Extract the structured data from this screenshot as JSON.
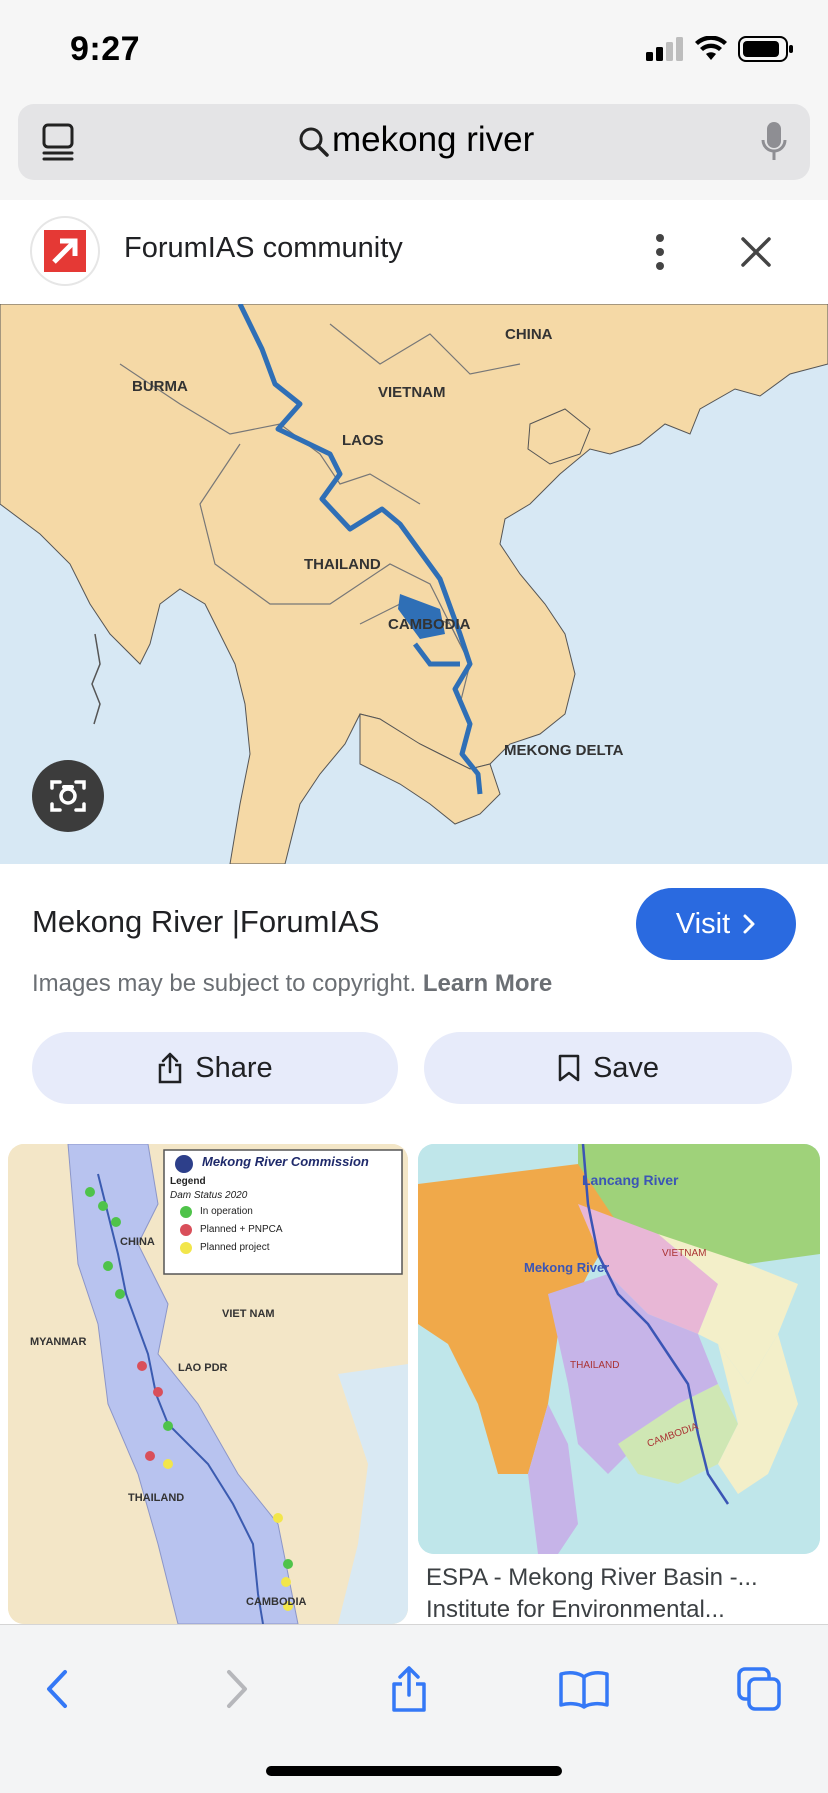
{
  "status_bar": {
    "time": "9:27"
  },
  "search": {
    "query": "mekong river"
  },
  "source": {
    "name": "ForumIAS community"
  },
  "map_labels": {
    "china": "CHINA",
    "burma": "BURMA",
    "vietnam": "VIETNAM",
    "laos": "LAOS",
    "thailand": "THAILAND",
    "cambodia": "CAMBODIA",
    "delta": "MEKONG DELTA"
  },
  "result": {
    "title": "Mekong River |ForumIAS",
    "visit_label": "Visit",
    "copyright_text": "Images may be subject to copyright.",
    "learn_more": "Learn More",
    "share_label": "Share",
    "save_label": "Save"
  },
  "related": [
    {
      "title": "Mekong River Commission",
      "legend": "Legend",
      "dam_status": "Dam Status 2020",
      "in_operation": "In operation",
      "planned_pnpca": "Planned + PNPCA",
      "planned": "Planned project",
      "labels": [
        "CHINA",
        "MYANMAR",
        "VIET NAM",
        "LAO PDR",
        "THAILAND",
        "CAMBODIA"
      ]
    },
    {
      "labels": [
        "Lancang River",
        "Mekong River",
        "VIETNAM",
        "THAILAND",
        "CAMBODIA"
      ],
      "caption_line1": "ESPA - Mekong River Basin -...",
      "caption_line2": "Institute for Environmental..."
    }
  ],
  "colors": {
    "land": "#f5d9a6",
    "water": "#d7e8f4",
    "river": "#2f6fb6",
    "accent": "#2a6ae0",
    "pill": "#e7ebfa",
    "ios_blue": "#3478f6"
  }
}
